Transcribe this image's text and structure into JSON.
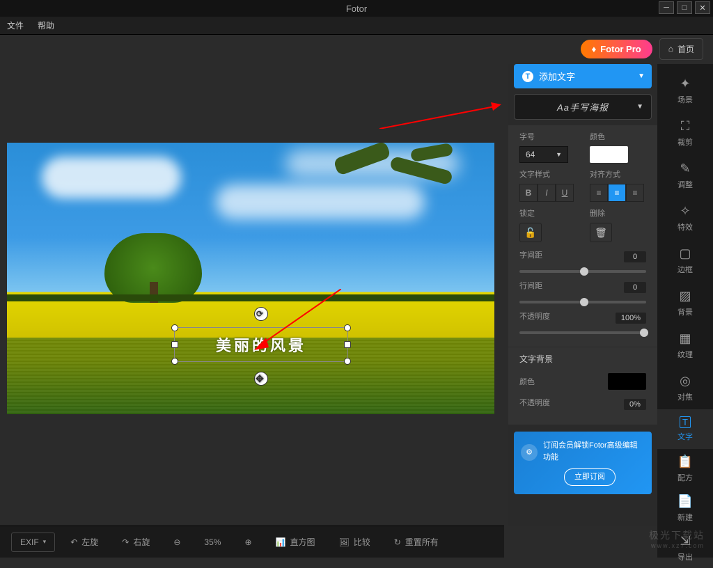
{
  "app": {
    "title": "Fotor"
  },
  "menu": {
    "file": "文件",
    "help": "帮助"
  },
  "top": {
    "pro": "Fotor Pro",
    "home": "首页"
  },
  "canvas": {
    "text": "美丽的风景"
  },
  "panel": {
    "addText": "添加文字",
    "font": "Aa手写海报",
    "sizeLabel": "字号",
    "sizeValue": "64",
    "colorLabel": "颜色",
    "styleLabel": "文字样式",
    "alignLabel": "对齐方式",
    "lockLabel": "锁定",
    "deleteLabel": "删除",
    "letterSpacing": "字间距",
    "letterSpacingVal": "0",
    "lineSpacing": "行间距",
    "lineSpacingVal": "0",
    "opacity": "不透明度",
    "opacityVal": "100%",
    "bgTitle": "文字背景",
    "bgColorLabel": "颜色",
    "bgOpacity": "不透明度",
    "bgOpacityVal": "0%"
  },
  "promo": {
    "text": "订阅会员解锁Fotor高级编辑功能",
    "btn": "立即订阅"
  },
  "sidebar": {
    "scene": "场景",
    "crop": "裁剪",
    "adjust": "调整",
    "effect": "特效",
    "border": "边框",
    "bg": "背景",
    "texture": "纹理",
    "focus": "对焦",
    "text": "文字",
    "recipe": "配方",
    "new": "新建",
    "export": "导出"
  },
  "bottom": {
    "exif": "EXIF",
    "rotL": "左旋",
    "rotR": "右旋",
    "zoom": "35%",
    "histogram": "直方图",
    "compare": "比较",
    "reset": "重置所有"
  },
  "watermark": {
    "main": "极光下载站",
    "sub": "www.xz7.com"
  }
}
